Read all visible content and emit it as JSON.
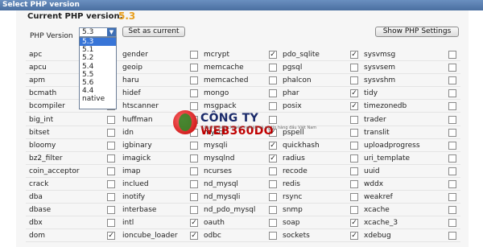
{
  "window": {
    "title": "Select PHP version"
  },
  "current": {
    "label": "Current PHP version:",
    "value": "5.3"
  },
  "php_version": {
    "label": "PHP Version",
    "selected": "5.3",
    "options": [
      "5.3",
      "5.1",
      "5.2",
      "5.4",
      "5.5",
      "5.6",
      "4.4",
      "native"
    ]
  },
  "buttons": {
    "set_current": "Set as current",
    "show_settings": "Show PHP Settings"
  },
  "logo": {
    "brand_a": "CÔNG TY ",
    "brand_b": "WEB360DO",
    "tagline": "Công ty web chuyên nghiệp và uy tín hàng đầu Việt Nam"
  },
  "extensions": [
    [
      {
        "n": "apc",
        "c": false
      },
      {
        "n": "gender",
        "c": false
      },
      {
        "n": "mcrypt",
        "c": true
      },
      {
        "n": "pdo_sqlite",
        "c": true
      },
      {
        "n": "sysvmsg",
        "c": false
      }
    ],
    [
      {
        "n": "apcu",
        "c": false
      },
      {
        "n": "geoip",
        "c": false
      },
      {
        "n": "memcache",
        "c": false
      },
      {
        "n": "pgsql",
        "c": false
      },
      {
        "n": "sysvsem",
        "c": false
      }
    ],
    [
      {
        "n": "apm",
        "c": false
      },
      {
        "n": "haru",
        "c": false
      },
      {
        "n": "memcached",
        "c": false
      },
      {
        "n": "phalcon",
        "c": false
      },
      {
        "n": "sysvshm",
        "c": false
      }
    ],
    [
      {
        "n": "bcmath",
        "c": false
      },
      {
        "n": "hidef",
        "c": false
      },
      {
        "n": "mongo",
        "c": false
      },
      {
        "n": "phar",
        "c": true
      },
      {
        "n": "tidy",
        "c": false
      }
    ],
    [
      {
        "n": "bcompiler",
        "c": false
      },
      {
        "n": "htscanner",
        "c": false
      },
      {
        "n": "msgpack",
        "c": false
      },
      {
        "n": "posix",
        "c": true
      },
      {
        "n": "timezonedb",
        "c": false
      }
    ],
    [
      {
        "n": "big_int",
        "c": false
      },
      {
        "n": "huffman",
        "c": false
      },
      {
        "n": "",
        "c": false
      },
      {
        "n": "",
        "c": false
      },
      {
        "n": "trader",
        "c": false
      }
    ],
    [
      {
        "n": "bitset",
        "c": false
      },
      {
        "n": "idn",
        "c": false
      },
      {
        "n": "mysql",
        "c": true
      },
      {
        "n": "pspell",
        "c": false
      },
      {
        "n": "translit",
        "c": false
      }
    ],
    [
      {
        "n": "bloomy",
        "c": false
      },
      {
        "n": "igbinary",
        "c": false
      },
      {
        "n": "mysqli",
        "c": true
      },
      {
        "n": "quickhash",
        "c": false
      },
      {
        "n": "uploadprogress",
        "c": false
      }
    ],
    [
      {
        "n": "bz2_filter",
        "c": false
      },
      {
        "n": "imagick",
        "c": false
      },
      {
        "n": "mysqlnd",
        "c": true
      },
      {
        "n": "radius",
        "c": false
      },
      {
        "n": "uri_template",
        "c": false
      }
    ],
    [
      {
        "n": "coin_acceptor",
        "c": false
      },
      {
        "n": "imap",
        "c": false
      },
      {
        "n": "ncurses",
        "c": false
      },
      {
        "n": "recode",
        "c": false
      },
      {
        "n": "uuid",
        "c": false
      }
    ],
    [
      {
        "n": "crack",
        "c": false
      },
      {
        "n": "inclued",
        "c": false
      },
      {
        "n": "nd_mysql",
        "c": false
      },
      {
        "n": "redis",
        "c": false
      },
      {
        "n": "wddx",
        "c": false
      }
    ],
    [
      {
        "n": "dba",
        "c": false
      },
      {
        "n": "inotify",
        "c": false
      },
      {
        "n": "nd_mysqli",
        "c": false
      },
      {
        "n": "rsync",
        "c": false
      },
      {
        "n": "weakref",
        "c": false
      }
    ],
    [
      {
        "n": "dbase",
        "c": false
      },
      {
        "n": "interbase",
        "c": false
      },
      {
        "n": "nd_pdo_mysql",
        "c": false
      },
      {
        "n": "snmp",
        "c": false
      },
      {
        "n": "xcache",
        "c": false
      }
    ],
    [
      {
        "n": "dbx",
        "c": false
      },
      {
        "n": "intl",
        "c": true
      },
      {
        "n": "oauth",
        "c": false
      },
      {
        "n": "soap",
        "c": true
      },
      {
        "n": "xcache_3",
        "c": false
      }
    ],
    [
      {
        "n": "dom",
        "c": true
      },
      {
        "n": "ioncube_loader",
        "c": true
      },
      {
        "n": "odbc",
        "c": false
      },
      {
        "n": "sockets",
        "c": true
      },
      {
        "n": "xdebug",
        "c": false
      }
    ]
  ]
}
